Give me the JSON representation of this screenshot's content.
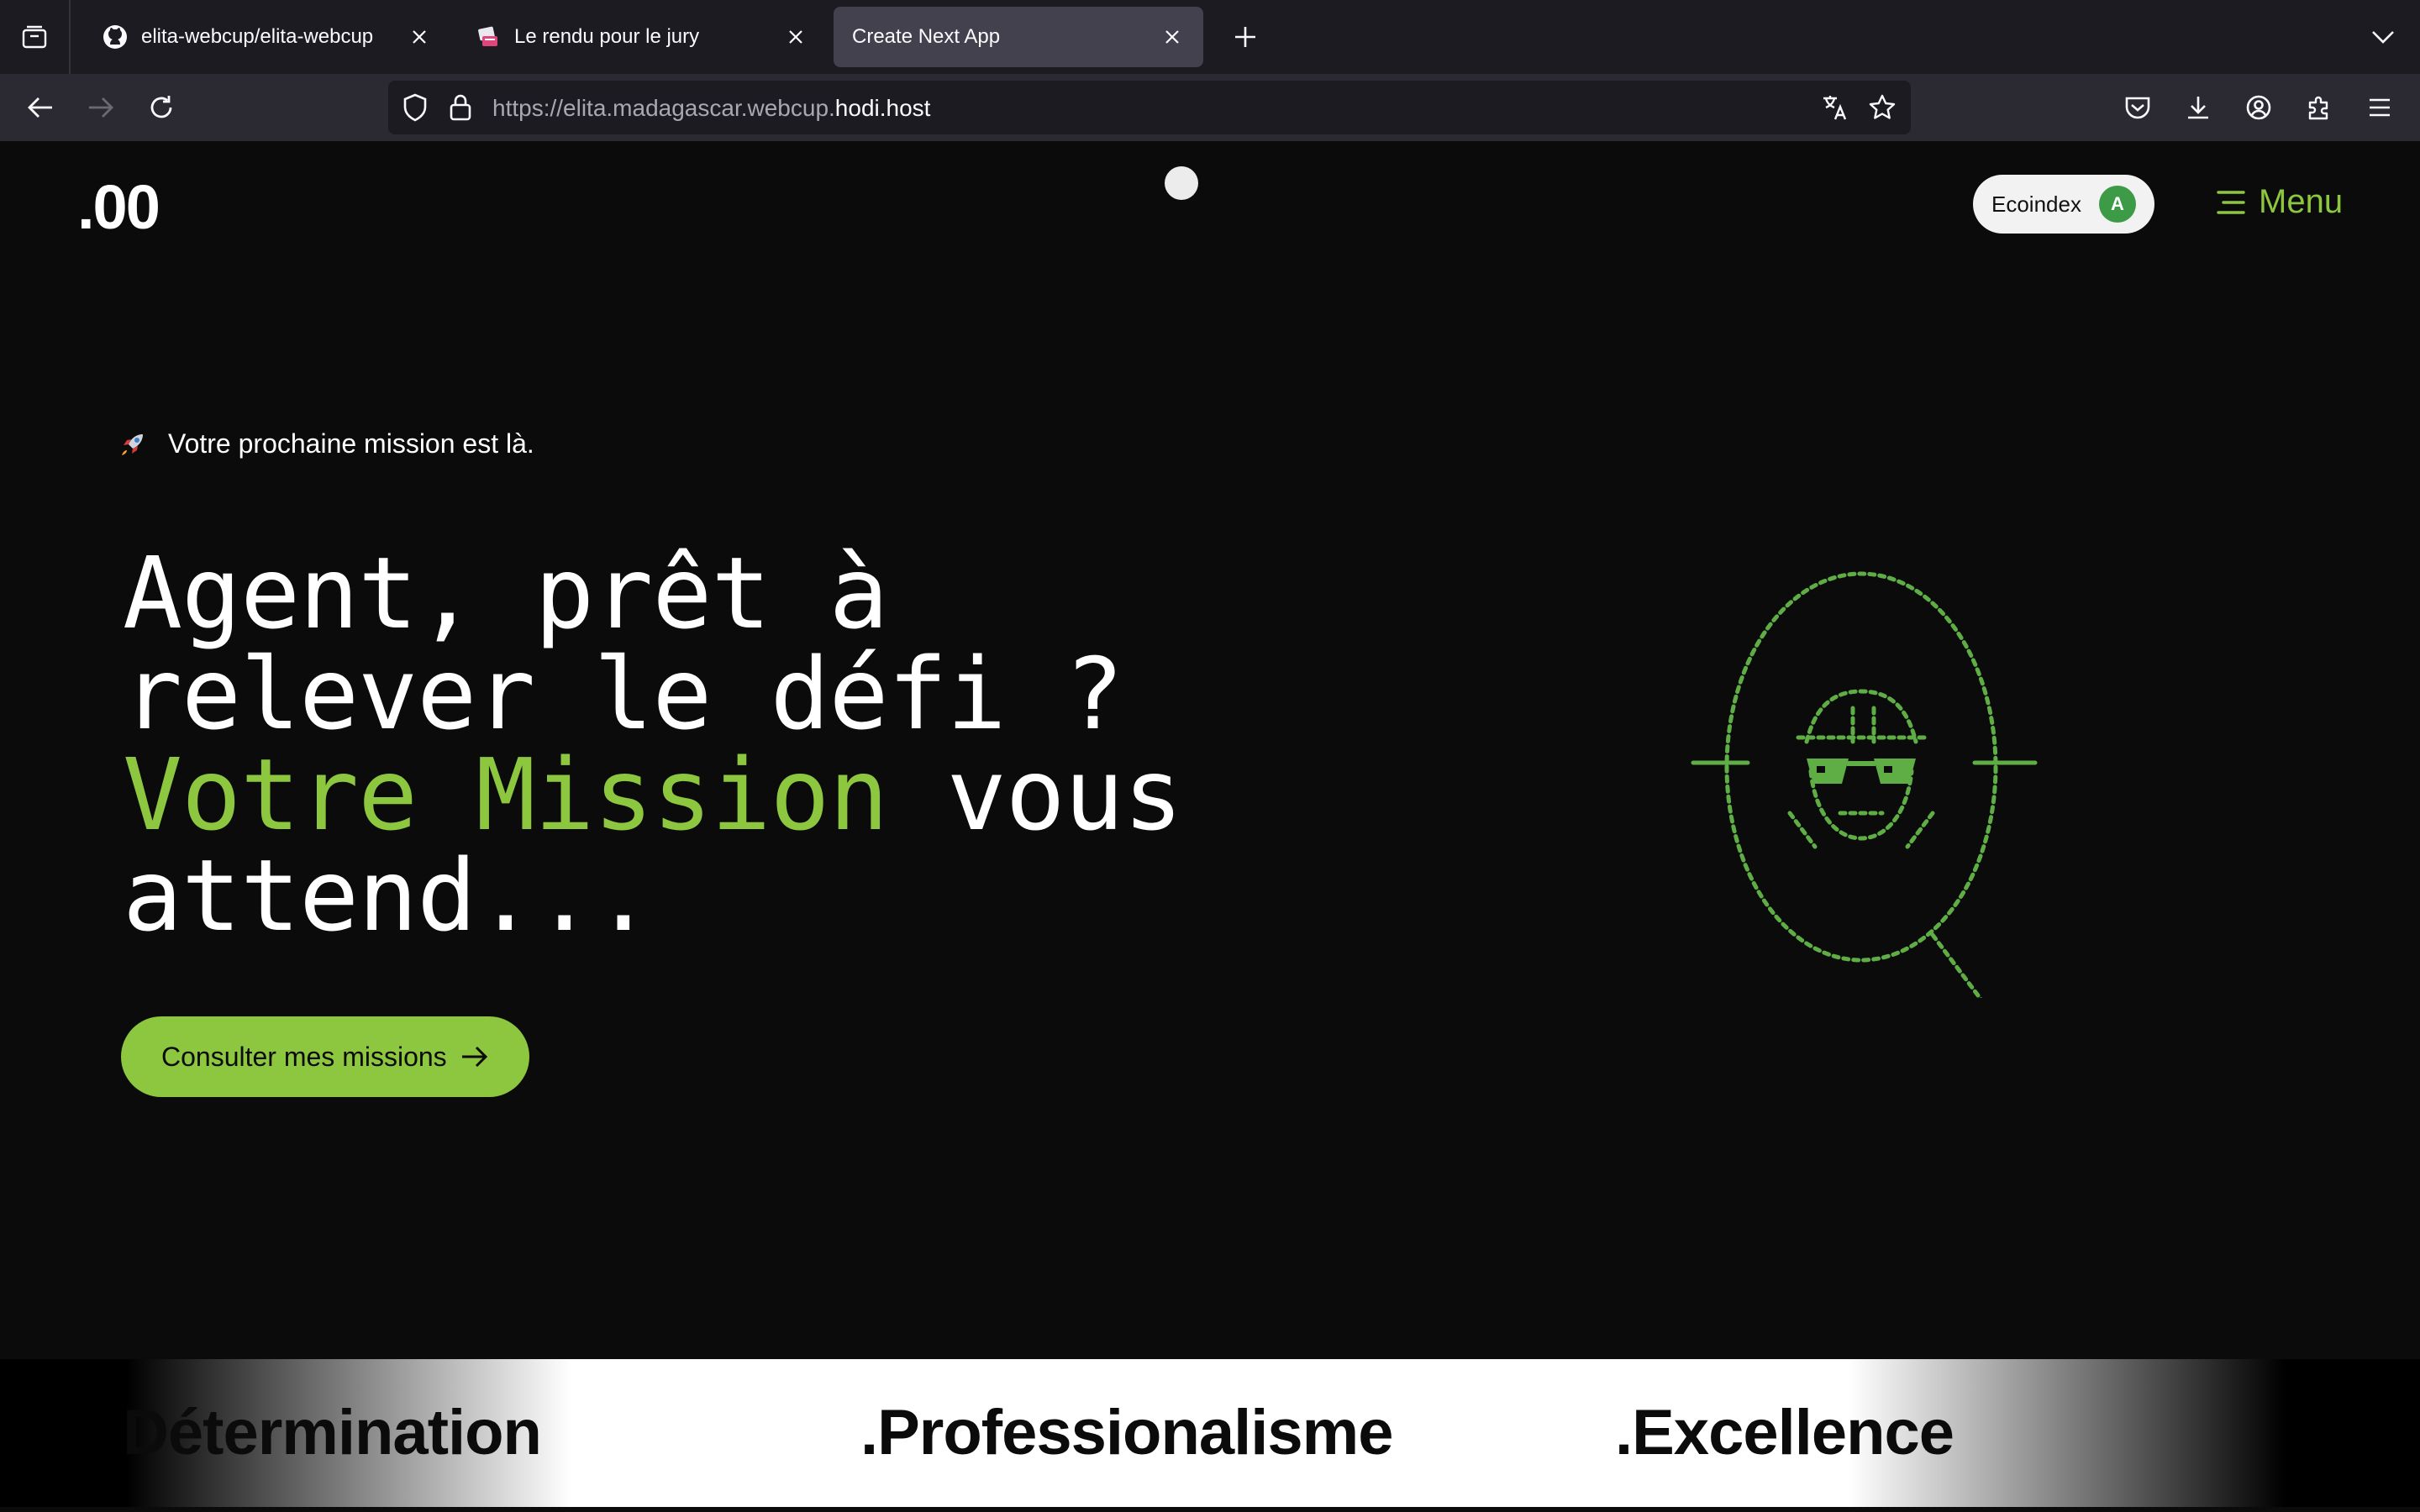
{
  "browser": {
    "tabs": [
      {
        "title": "elita-webcup/elita-webcup",
        "icon": "github-icon"
      },
      {
        "title": "Le rendu pour le jury",
        "icon": "pink-favicon-icon"
      },
      {
        "title": "Create Next App",
        "icon": "none",
        "active": true
      }
    ],
    "url": {
      "prefix": "https://elita.madagascar.webcup.",
      "host": "hodi.host"
    }
  },
  "page": {
    "logo": ".00",
    "ecoindex": {
      "label": "Ecoindex",
      "grade": "A"
    },
    "menu_label": "Menu",
    "tagline": "Votre prochaine mission est là.",
    "hero": {
      "line1": "Agent, prêt à",
      "line2": "relever le défi ?",
      "line3_green": "Votre Mission",
      "line3_rest": " vous",
      "line4": "attend..."
    },
    "cta_label": "Consulter mes missions",
    "ticker": [
      "Détermination",
      ".Professionalisme",
      ".Excellence"
    ]
  },
  "colors": {
    "accent_green": "#8dc63f",
    "ecoindex_green": "#3d9b47",
    "page_bg": "#0b0b0b"
  }
}
